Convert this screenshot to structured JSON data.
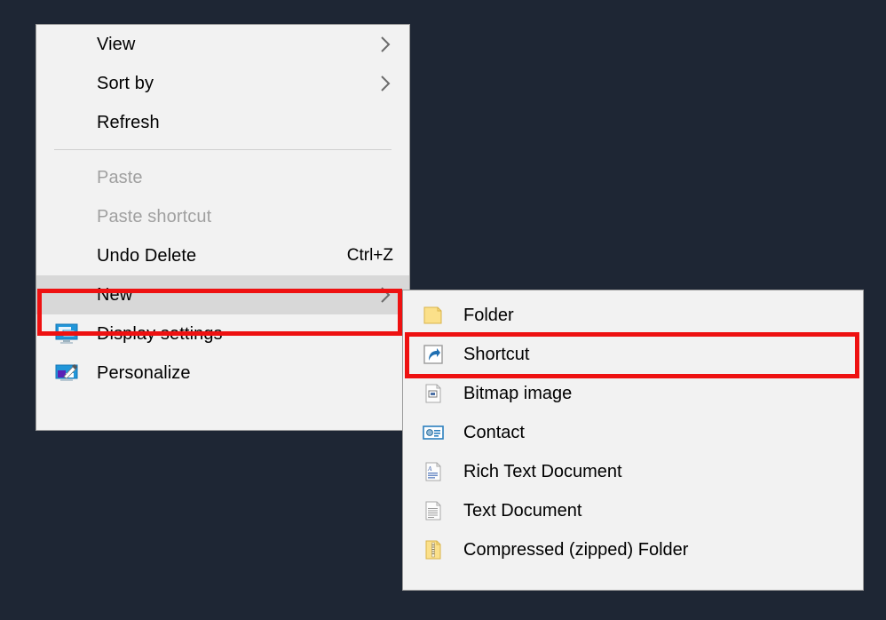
{
  "desktop": {
    "background_color": "#1e2634"
  },
  "context_menu": {
    "name": "desktop-context-menu",
    "items": [
      {
        "label": "View",
        "icon": "none",
        "submenu_arrow": true,
        "disabled": false,
        "highlighted": false,
        "accelerator": ""
      },
      {
        "label": "Sort by",
        "icon": "none",
        "submenu_arrow": true,
        "disabled": false,
        "highlighted": false,
        "accelerator": ""
      },
      {
        "label": "Refresh",
        "icon": "none",
        "submenu_arrow": false,
        "disabled": false,
        "highlighted": false,
        "accelerator": ""
      },
      {
        "label": "Paste",
        "icon": "none",
        "submenu_arrow": false,
        "disabled": true,
        "highlighted": false,
        "accelerator": ""
      },
      {
        "label": "Paste shortcut",
        "icon": "none",
        "submenu_arrow": false,
        "disabled": true,
        "highlighted": false,
        "accelerator": ""
      },
      {
        "label": "Undo Delete",
        "icon": "none",
        "submenu_arrow": false,
        "disabled": false,
        "highlighted": false,
        "accelerator": "Ctrl+Z"
      },
      {
        "label": "New",
        "icon": "none",
        "submenu_arrow": true,
        "disabled": false,
        "highlighted": true,
        "accelerator": ""
      },
      {
        "label": "Display settings",
        "icon": "monitor-icon",
        "submenu_arrow": false,
        "disabled": false,
        "highlighted": false,
        "accelerator": ""
      },
      {
        "label": "Personalize",
        "icon": "paintbrush-monitor-icon",
        "submenu_arrow": false,
        "disabled": false,
        "highlighted": false,
        "accelerator": ""
      }
    ],
    "separator_after_index": 2
  },
  "submenu": {
    "name": "new-submenu",
    "items": [
      {
        "label": "Folder",
        "icon": "folder-icon"
      },
      {
        "label": "Shortcut",
        "icon": "shortcut-arrow-icon"
      },
      {
        "label": "Bitmap image",
        "icon": "bitmap-image-icon"
      },
      {
        "label": "Contact",
        "icon": "contact-card-icon"
      },
      {
        "label": "Rich Text Document",
        "icon": "rich-text-document-icon"
      },
      {
        "label": "Text Document",
        "icon": "text-document-icon"
      },
      {
        "label": "Compressed (zipped) Folder",
        "icon": "zipped-folder-icon"
      }
    ]
  },
  "annotations": {
    "color": "#ee1111",
    "boxes": [
      {
        "target": "New",
        "name": "new-highlight-box"
      },
      {
        "target": "Shortcut",
        "name": "shortcut-highlight-box"
      }
    ]
  }
}
